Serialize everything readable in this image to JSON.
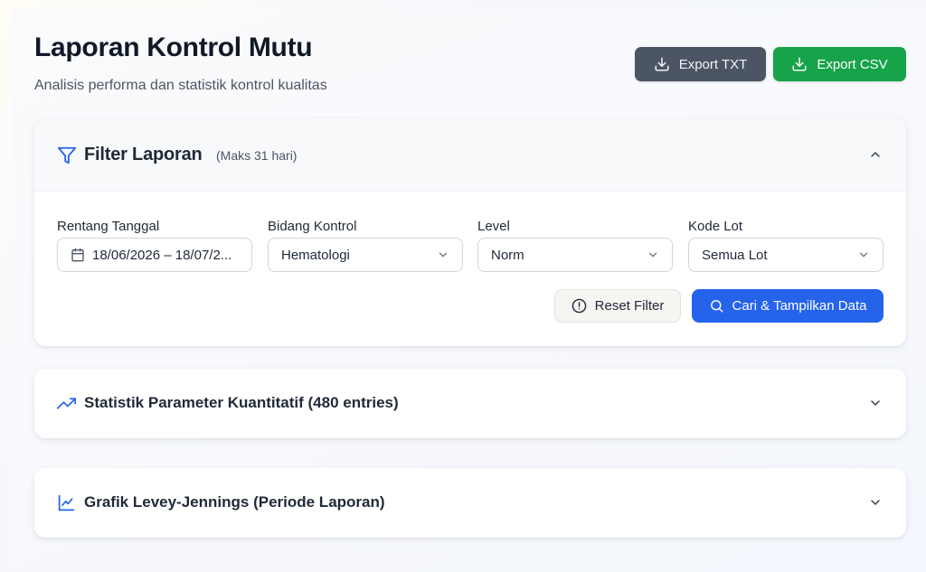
{
  "header": {
    "title": "Laporan Kontrol Mutu",
    "subtitle": "Analisis performa dan statistik kontrol kualitas",
    "export_txt_label": "Export TXT",
    "export_csv_label": "Export CSV"
  },
  "filter": {
    "title": "Filter Laporan",
    "note": "(Maks 31 hari)",
    "fields": {
      "date_range": {
        "label": "Rentang Tanggal",
        "value": "18/06/2026 – 18/07/2..."
      },
      "bidang": {
        "label": "Bidang Kontrol",
        "value": "Hematologi"
      },
      "level": {
        "label": "Level",
        "value": "Norm"
      },
      "lot": {
        "label": "Kode Lot",
        "value": "Semua Lot"
      }
    },
    "reset_label": "Reset Filter",
    "search_label": "Cari & Tampilkan Data"
  },
  "sections": {
    "stats_title": "Statistik Parameter Kuantitatif (480 entries)",
    "lj_title": "Grafik Levey-Jennings (Periode Laporan)"
  },
  "colors": {
    "primary": "#2563eb",
    "success": "#16a34a",
    "neutral_button": "#4b5563"
  },
  "icons": {
    "export": "download-icon",
    "filter": "filter-icon",
    "collapse": "chevron-up-icon",
    "expand": "chevron-down-icon",
    "calendar": "calendar-icon",
    "reset": "alert-circle-icon",
    "search": "search-icon",
    "stats": "trending-up-icon",
    "chart": "line-chart-icon"
  }
}
